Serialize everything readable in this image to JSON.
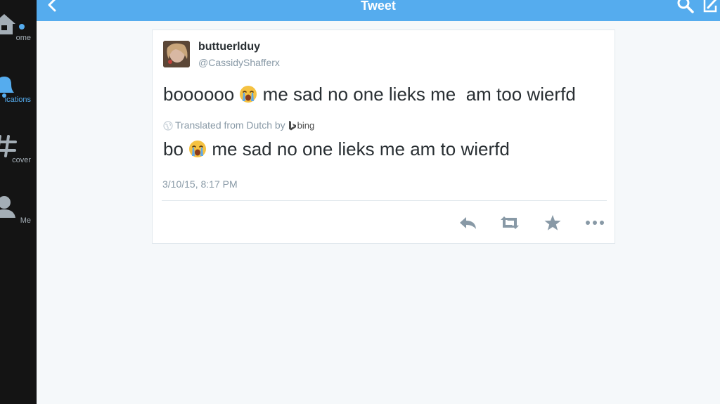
{
  "app": {
    "title": "Tweet"
  },
  "sidebar": {
    "items": [
      {
        "label": "ome",
        "icon": "home-icon",
        "active": false,
        "has_notification_dot": true
      },
      {
        "label": "ications",
        "icon": "bell-icon",
        "active": true
      },
      {
        "label": "cover",
        "icon": "hashtag-icon",
        "active": false
      },
      {
        "label": "Me",
        "icon": "person-icon",
        "active": false
      }
    ]
  },
  "topbar": {
    "back_icon": "chevron-left-icon",
    "search_icon": "search-icon",
    "compose_icon": "compose-icon"
  },
  "tweet": {
    "display_name": "buttuerlduy",
    "handle": "@CassidyShafferx",
    "text_before_emoji": "boooooo ",
    "text_after_emoji": " me sad no one lieks me  am too wierfd",
    "emoji": "crying-face",
    "translation_label": "Translated from Dutch by",
    "translator": "bing",
    "translated_before_emoji": "bo ",
    "translated_after_emoji": " me sad no one lieks me am to wierfd",
    "timestamp": "3/10/15, 8:17 PM"
  },
  "actions": [
    {
      "name": "reply-button",
      "icon": "reply-icon"
    },
    {
      "name": "retweet-button",
      "icon": "retweet-icon"
    },
    {
      "name": "favorite-button",
      "icon": "star-icon"
    },
    {
      "name": "more-button",
      "icon": "more-icon"
    }
  ],
  "colors": {
    "accent": "#55acee",
    "sidebar_bg": "#141414",
    "action_icon": "#8899a6",
    "text": "#292f33",
    "muted": "#8899a6"
  }
}
